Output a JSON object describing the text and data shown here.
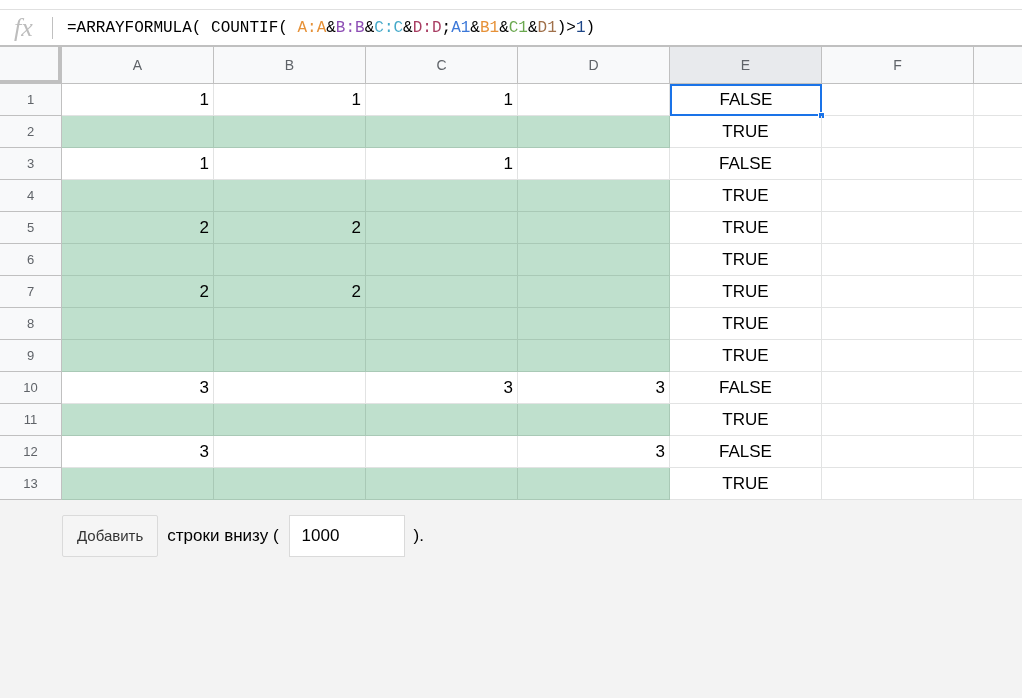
{
  "formula_bar": {
    "function_label": "fx",
    "formula": [
      {
        "text": "=ARRAYFORMULA( COUNTIF( "
      },
      {
        "text": "A:A",
        "color": "#e69138"
      },
      {
        "text": "&"
      },
      {
        "text": "B:B",
        "color": "#8e4fb5"
      },
      {
        "text": "&"
      },
      {
        "text": "C:C",
        "color": "#45a9c9"
      },
      {
        "text": "&"
      },
      {
        "text": "D:D",
        "color": "#a83d62"
      },
      {
        "text": ";"
      },
      {
        "text": "A1",
        "color": "#3c78d8"
      },
      {
        "text": "&"
      },
      {
        "text": "B1",
        "color": "#e69138"
      },
      {
        "text": "&"
      },
      {
        "text": "C1",
        "color": "#6aa84f"
      },
      {
        "text": "&"
      },
      {
        "text": "D1",
        "color": "#a0704a"
      },
      {
        "text": ")>"
      },
      {
        "text": "1",
        "color": "#1c4587"
      },
      {
        "text": ")"
      }
    ]
  },
  "columns": [
    {
      "label": "A",
      "selected": false
    },
    {
      "label": "B",
      "selected": false
    },
    {
      "label": "C",
      "selected": false
    },
    {
      "label": "D",
      "selected": false
    },
    {
      "label": "E",
      "selected": true
    },
    {
      "label": "F",
      "selected": false
    }
  ],
  "rows": [
    {
      "number": "1",
      "highlighted": false,
      "values": {
        "a": "1",
        "b": "1",
        "c": "1"
      },
      "result": {
        "text": "FALSE",
        "selected": true
      }
    },
    {
      "number": "2",
      "highlighted": true,
      "values": {},
      "result": {
        "text": "TRUE",
        "selected": false
      }
    },
    {
      "number": "3",
      "highlighted": false,
      "values": {
        "a": "1",
        "c": "1"
      },
      "result": {
        "text": "FALSE",
        "selected": false
      }
    },
    {
      "number": "4",
      "highlighted": true,
      "values": {},
      "result": {
        "text": "TRUE",
        "selected": false
      }
    },
    {
      "number": "5",
      "highlighted": true,
      "values": {
        "a": "2",
        "b": "2"
      },
      "result": {
        "text": "TRUE",
        "selected": false
      }
    },
    {
      "number": "6",
      "highlighted": true,
      "values": {},
      "result": {
        "text": "TRUE",
        "selected": false
      }
    },
    {
      "number": "7",
      "highlighted": true,
      "values": {
        "a": "2",
        "b": "2"
      },
      "result": {
        "text": "TRUE",
        "selected": false
      }
    },
    {
      "number": "8",
      "highlighted": true,
      "values": {},
      "result": {
        "text": "TRUE",
        "selected": false
      }
    },
    {
      "number": "9",
      "highlighted": true,
      "values": {},
      "result": {
        "text": "TRUE",
        "selected": false
      }
    },
    {
      "number": "10",
      "highlighted": false,
      "values": {
        "a": "3",
        "c": "3",
        "d": "3"
      },
      "result": {
        "text": "FALSE",
        "selected": false
      }
    },
    {
      "number": "11",
      "highlighted": true,
      "values": {},
      "result": {
        "text": "TRUE",
        "selected": false
      }
    },
    {
      "number": "12",
      "highlighted": false,
      "values": {
        "a": "3",
        "d": "3"
      },
      "result": {
        "text": "FALSE",
        "selected": false
      }
    },
    {
      "number": "13",
      "highlighted": true,
      "values": {},
      "result": {
        "text": "TRUE",
        "selected": false
      }
    }
  ],
  "add_rows": {
    "button": "Добавить",
    "label": "строки внизу (",
    "value": "1000",
    "suffix": ")."
  }
}
